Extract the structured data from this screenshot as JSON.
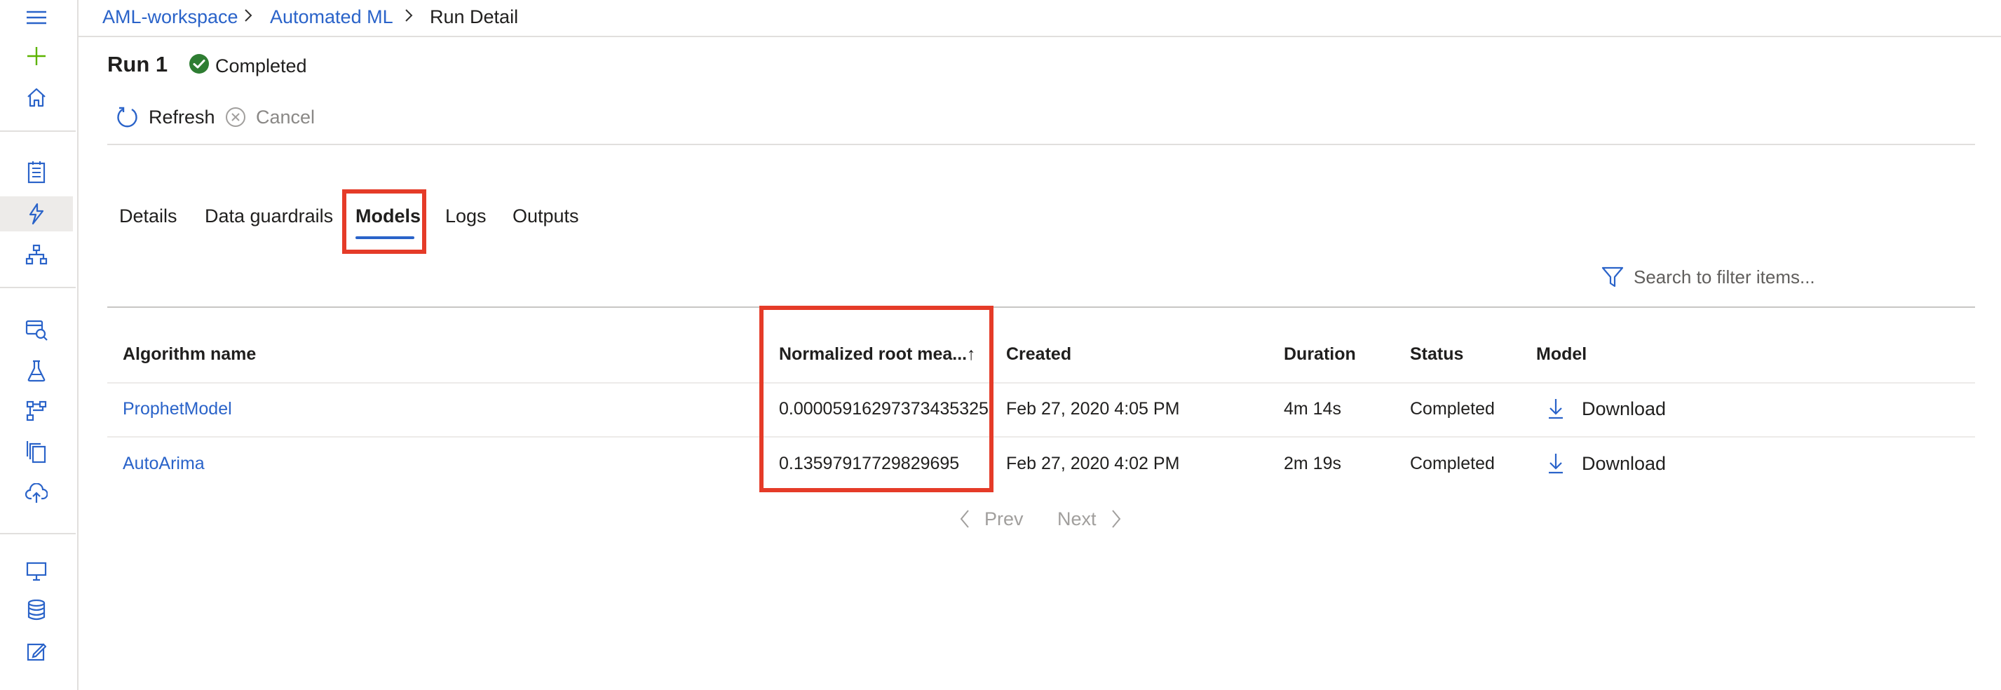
{
  "breadcrumb": {
    "workspace": "AML-workspace",
    "section": "Automated ML",
    "current": "Run Detail"
  },
  "run": {
    "title": "Run 1",
    "status": "Completed"
  },
  "commands": {
    "refresh": "Refresh",
    "cancel": "Cancel"
  },
  "tabs": [
    {
      "label": "Details"
    },
    {
      "label": "Data guardrails"
    },
    {
      "label": "Models",
      "active": true
    },
    {
      "label": "Logs"
    },
    {
      "label": "Outputs"
    }
  ],
  "search": {
    "placeholder": "Search to filter items..."
  },
  "table": {
    "columns": {
      "algorithm": "Algorithm name",
      "metric": "Normalized root mea...",
      "metric_sort": "↑",
      "created": "Created",
      "duration": "Duration",
      "status": "Status",
      "model": "Model"
    },
    "rows": [
      {
        "algorithm": "ProphetModel",
        "metric": "0.00005916297373435325",
        "created": "Feb 27, 2020 4:05 PM",
        "duration": "4m 14s",
        "status": "Completed",
        "model": "Download"
      },
      {
        "algorithm": "AutoArima",
        "metric": "0.13597917729829695",
        "created": "Feb 27, 2020 4:02 PM",
        "duration": "2m 19s",
        "status": "Completed",
        "model": "Download"
      }
    ]
  },
  "pager": {
    "prev": "Prev",
    "next": "Next"
  },
  "colors": {
    "accent": "#2a63c9",
    "highlight": "#e53b28",
    "success": "#2e7d32",
    "add": "#5db300"
  },
  "icons": {
    "rail": [
      "menu-icon",
      "plus-icon",
      "home-icon",
      "notebook-icon",
      "automl-icon",
      "designer-icon",
      "datasets-icon",
      "experiments-icon",
      "pipelines-icon",
      "models-icon",
      "endpoints-icon",
      "compute-icon",
      "datastores-icon",
      "labeling-icon"
    ],
    "status": "check-circle-icon",
    "refresh": "refresh-icon",
    "cancel": "cancel-icon",
    "search": "filter-icon",
    "download": "download-icon"
  }
}
